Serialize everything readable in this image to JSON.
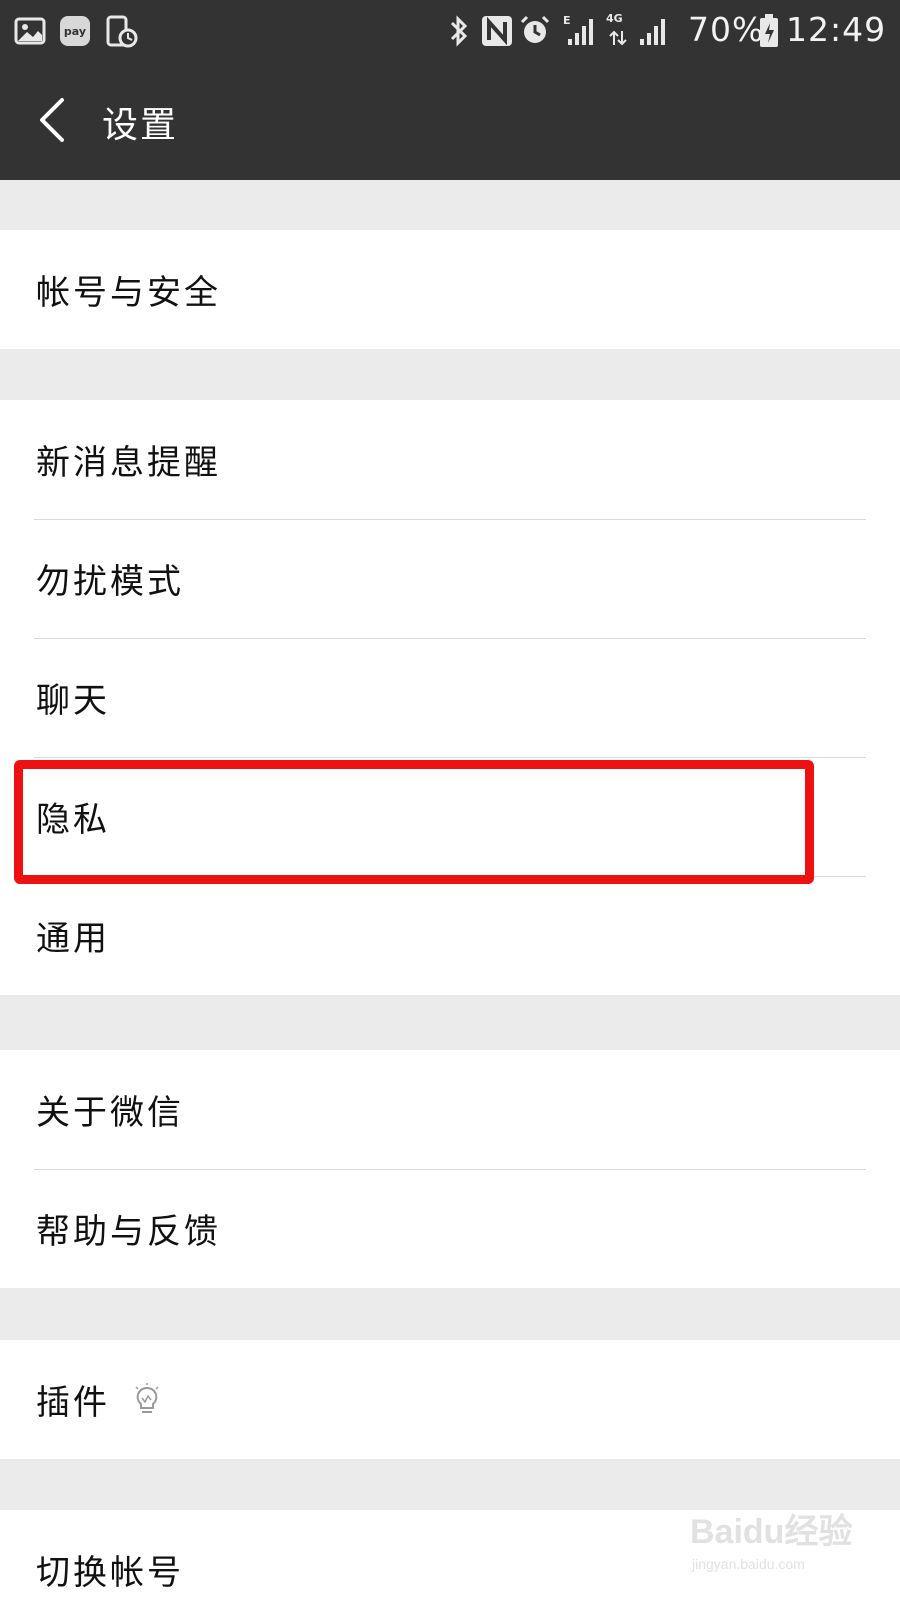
{
  "status_bar": {
    "pay_label": "pay",
    "network_e": "E",
    "network_4g": "4G",
    "battery_percent": "70%",
    "time": "12:49",
    "icons": [
      "gallery-icon",
      "pay-icon",
      "screen-timer-icon",
      "bluetooth-icon",
      "nfc-icon",
      "alarm-icon",
      "signal-icon",
      "battery-icon"
    ]
  },
  "header": {
    "title": "设置",
    "back_icon": "back-arrow-icon"
  },
  "groups": [
    {
      "items": [
        {
          "label": "帐号与安全"
        }
      ]
    },
    {
      "items": [
        {
          "label": "新消息提醒"
        },
        {
          "label": "勿扰模式"
        },
        {
          "label": "聊天"
        },
        {
          "label": "隐私"
        },
        {
          "label": "通用"
        }
      ]
    },
    {
      "items": [
        {
          "label": "关于微信"
        },
        {
          "label": "帮助与反馈"
        }
      ]
    },
    {
      "items": [
        {
          "label": "插件",
          "icon": "lightbulb-icon"
        }
      ]
    },
    {
      "items": [
        {
          "label": "切换帐号"
        }
      ]
    }
  ],
  "highlight": {
    "target": "隐私",
    "color": "#ee1111"
  },
  "watermark": {
    "brand": "Baidu经验",
    "url": "jingyan.baidu.com"
  },
  "colors": {
    "header_bg": "#333333",
    "page_bg": "#ebebeb",
    "row_bg": "#ffffff",
    "divider": "#d9d9d9"
  }
}
